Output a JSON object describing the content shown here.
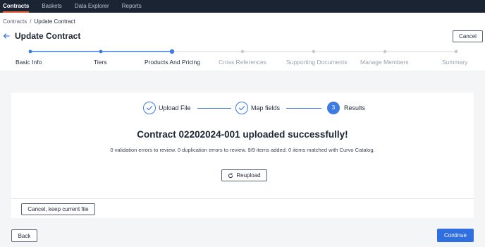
{
  "topnav": {
    "items": [
      {
        "label": "Contracts",
        "active": true
      },
      {
        "label": "Baskets",
        "active": false
      },
      {
        "label": "Data Explorer",
        "active": false
      },
      {
        "label": "Reports",
        "active": false
      }
    ]
  },
  "breadcrumb": {
    "parent": "Contracts",
    "separator": "/",
    "current": "Update Contract"
  },
  "header": {
    "title": "Update Contract",
    "cancel_label": "Cancel"
  },
  "stepper": {
    "steps": [
      {
        "label": "Basic Info",
        "status": "done"
      },
      {
        "label": "Tiers",
        "status": "done"
      },
      {
        "label": "Products And Pricing",
        "status": "current"
      },
      {
        "label": "Cross References",
        "status": "pending"
      },
      {
        "label": "Supporting Documents",
        "status": "pending"
      },
      {
        "label": "Manage Members",
        "status": "pending"
      },
      {
        "label": "Summary",
        "status": "pending"
      }
    ]
  },
  "upload": {
    "steps": [
      {
        "label": "Upload File",
        "state": "done"
      },
      {
        "label": "Map fields",
        "state": "done"
      },
      {
        "label": "Results",
        "state": "current",
        "number": "3"
      }
    ],
    "heading": "Contract 02202024-001 uploaded successfully!",
    "summary": "0 validation errors to review. 0 duplication errors to review. 9/9 items added. 0 items matched with Curvo Catalog.",
    "reupload_label": "Reupload",
    "keep_label": "Cancel, keep current file"
  },
  "footer": {
    "back_label": "Back",
    "continue_label": "Continue"
  },
  "colors": {
    "nav_bg": "#1b2433",
    "accent": "#2f6fe0",
    "active_tab_underline": "#e4572e"
  }
}
